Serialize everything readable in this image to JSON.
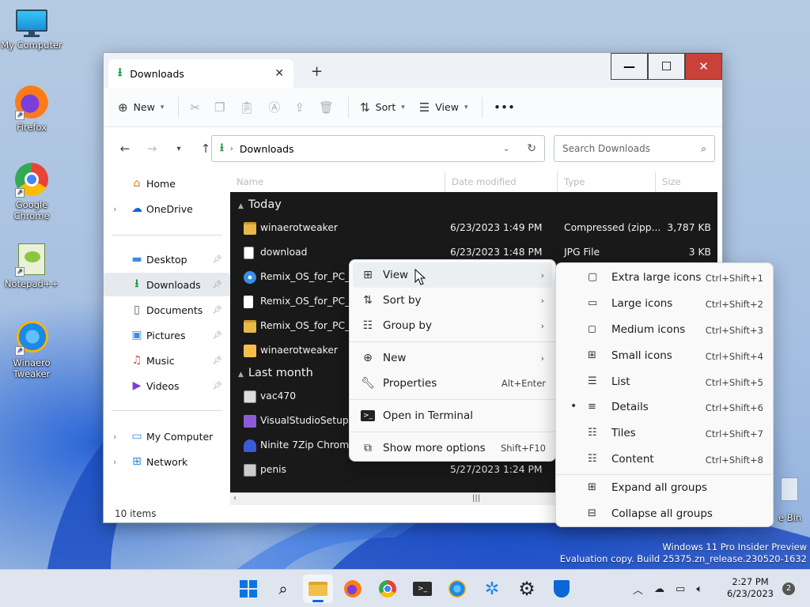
{
  "desktop": {
    "icons": [
      {
        "label": "My Computer"
      },
      {
        "label": "Firefox"
      },
      {
        "label": "Google Chrome"
      },
      {
        "label": "Notepad++"
      },
      {
        "label": "Winaero Tweaker"
      },
      {
        "label": "e Bin"
      }
    ],
    "watermark": {
      "line1": "Windows 11 Pro Insider Preview",
      "line2": "Evaluation copy. Build 25375.zn_release.230520-1632"
    }
  },
  "window": {
    "tab_title": "Downloads",
    "tab_close": "✕",
    "new_tab": "+",
    "controls": {
      "minimize": "—",
      "maximize": "☐",
      "close": "✕"
    }
  },
  "toolbar": {
    "new_label": "New",
    "sort_label": "Sort",
    "view_label": "View",
    "more_label": "•••"
  },
  "address": {
    "path": "Downloads",
    "search_placeholder": "Search Downloads"
  },
  "sidebar": {
    "items": [
      {
        "label": "Home"
      },
      {
        "label": "OneDrive"
      },
      {
        "label": "Desktop"
      },
      {
        "label": "Downloads"
      },
      {
        "label": "Documents"
      },
      {
        "label": "Pictures"
      },
      {
        "label": "Music"
      },
      {
        "label": "Videos"
      },
      {
        "label": "My Computer"
      },
      {
        "label": "Network"
      }
    ]
  },
  "status": {
    "items": "10 items"
  },
  "files": {
    "columns": [
      "Name",
      "Date modified",
      "Type",
      "Size"
    ],
    "groups": [
      {
        "label": "Today"
      },
      {
        "label": "Last month"
      }
    ],
    "rows": [
      {
        "name": "winaerotweaker",
        "date": "6/23/2023 1:49 PM",
        "type": "Compressed (zipp...",
        "size": "3,787 KB"
      },
      {
        "name": "download",
        "date": "6/23/2023 1:48 PM",
        "type": "JPG File",
        "size": "3 KB"
      },
      {
        "name": "Remix_OS_for_PC_Ins",
        "date": "",
        "type": "",
        "size": ""
      },
      {
        "name": "Remix_OS_for_PC_An",
        "date": "",
        "type": "",
        "size": ""
      },
      {
        "name": "Remix_OS_for_PC_An",
        "date": "",
        "type": "",
        "size": ""
      },
      {
        "name": "winaerotweaker",
        "date": "",
        "type": "",
        "size": ""
      },
      {
        "name": "vac470",
        "date": "",
        "type": "",
        "size": ""
      },
      {
        "name": "VisualStudioSetup",
        "date": "",
        "type": "",
        "size": ""
      },
      {
        "name": "Ninite 7Zip Chrome F",
        "date": "",
        "type": "",
        "size": ""
      },
      {
        "name": "penis",
        "date": "5/27/2023 1:24 PM",
        "type": "",
        "size": ""
      }
    ]
  },
  "context_menu": {
    "items": [
      {
        "label": "View",
        "shortcut": ""
      },
      {
        "label": "Sort by",
        "shortcut": ""
      },
      {
        "label": "Group by",
        "shortcut": ""
      },
      {
        "label": "New",
        "shortcut": ""
      },
      {
        "label": "Properties",
        "shortcut": "Alt+Enter"
      },
      {
        "label": "Open in Terminal",
        "shortcut": ""
      },
      {
        "label": "Show more options",
        "shortcut": "Shift+F10"
      }
    ]
  },
  "view_submenu": {
    "items": [
      {
        "label": "Extra large icons",
        "shortcut": "Ctrl+Shift+1"
      },
      {
        "label": "Large icons",
        "shortcut": "Ctrl+Shift+2"
      },
      {
        "label": "Medium icons",
        "shortcut": "Ctrl+Shift+3"
      },
      {
        "label": "Small icons",
        "shortcut": "Ctrl+Shift+4"
      },
      {
        "label": "List",
        "shortcut": "Ctrl+Shift+5"
      },
      {
        "label": "Details",
        "shortcut": "Ctrl+Shift+6"
      },
      {
        "label": "Tiles",
        "shortcut": "Ctrl+Shift+7"
      },
      {
        "label": "Content",
        "shortcut": "Ctrl+Shift+8"
      },
      {
        "label": "Expand all groups",
        "shortcut": ""
      },
      {
        "label": "Collapse all groups",
        "shortcut": ""
      }
    ],
    "selected": "Details"
  },
  "taskbar": {
    "time": "2:27 PM",
    "date": "6/23/2023",
    "notifications": "2"
  }
}
